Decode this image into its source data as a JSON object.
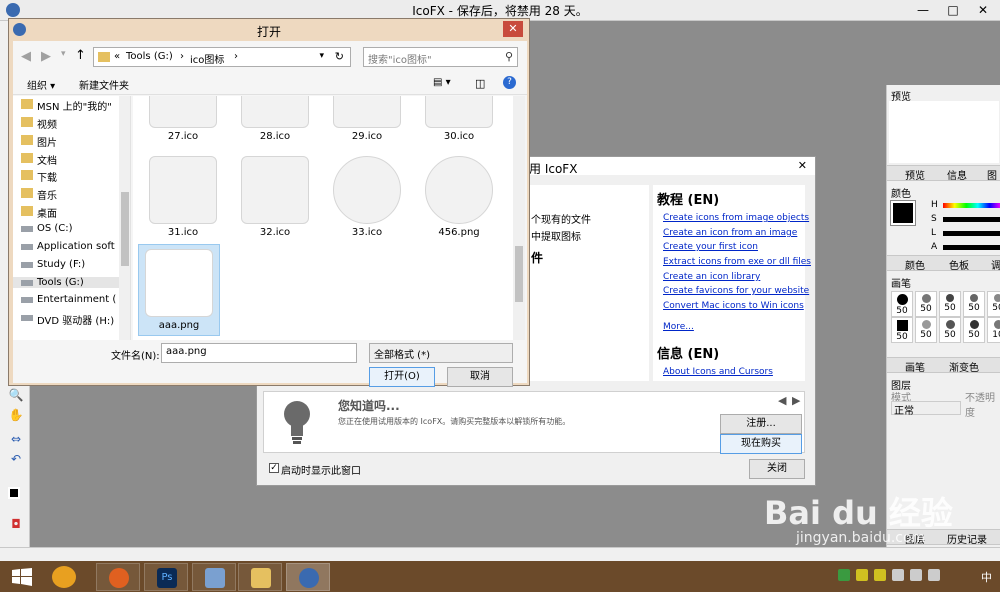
{
  "app": {
    "title": "IcoFX - 保存后，将禁用 28 天。"
  },
  "colors": {
    "taskbar": "#6b4a2a",
    "dialog_frame": "#eed9c0",
    "link": "#0026c8",
    "selection": "#cce4f7"
  },
  "file_dialog": {
    "title": "打开",
    "address": [
      "«",
      "Tools (G:)",
      "›",
      "ico图标",
      "›"
    ],
    "search_placeholder": "搜索\"ico图标\"",
    "organize": "组织 ▾",
    "new_folder": "新建文件夹",
    "nav_items": [
      {
        "label": "MSN 上的\"我的\"",
        "icon": "folder-icon"
      },
      {
        "label": "视频",
        "icon": "folder-icon"
      },
      {
        "label": "图片",
        "icon": "folder-icon"
      },
      {
        "label": "文档",
        "icon": "folder-icon"
      },
      {
        "label": "下载",
        "icon": "folder-icon"
      },
      {
        "label": "音乐",
        "icon": "folder-icon"
      },
      {
        "label": "桌面",
        "icon": "folder-icon"
      },
      {
        "label": "OS (C:)",
        "icon": "drive-icon"
      },
      {
        "label": "Application soft",
        "icon": "drive-icon"
      },
      {
        "label": "Study (F:)",
        "icon": "drive-icon"
      },
      {
        "label": "Tools (G:)",
        "icon": "drive-icon"
      },
      {
        "label": "Entertainment (",
        "icon": "drive-icon"
      },
      {
        "label": "DVD 驱动器 (H:)",
        "icon": "drive-icon"
      }
    ],
    "files": [
      {
        "name": "27.ico"
      },
      {
        "name": "28.ico"
      },
      {
        "name": "29.ico"
      },
      {
        "name": "30.ico"
      },
      {
        "name": "31.ico"
      },
      {
        "name": "32.ico"
      },
      {
        "name": "33.ico"
      },
      {
        "name": "456.png"
      },
      {
        "name": "aaa.png"
      }
    ],
    "filename_label": "文件名(N):",
    "filename_value": "aaa.png",
    "filetype_value": "全部格式 (*)",
    "open_button": "打开(O)",
    "cancel_button": "取消"
  },
  "welcome": {
    "title_partial": "用 IcoFX",
    "left_lines": [
      "个现有的文件",
      "中提取图标",
      "件"
    ],
    "tutorials_heading": "教程 (EN)",
    "tutorial_links": [
      "Create icons from image objects",
      "Create an icon from an image",
      "Create your first icon",
      "Extract icons from exe or dll files",
      "Create an icon library",
      "Create favicons for your website",
      "Convert Mac icons to Win icons"
    ],
    "more": "More...",
    "info_heading": "信息 (EN)",
    "info_link": "About Icons and Cursors",
    "tip_title": "您知道吗...",
    "tip_text": "您正在使用试用版本的 IcoFX。请购买完整版本以解锁所有功能。",
    "register_button": "注册...",
    "buy_button": "现在购买",
    "show_at_startup": "启动时显示此窗口",
    "close_button": "关闭"
  },
  "right_panel": {
    "preview": "预览",
    "tabs1": [
      "预览",
      "信息",
      "图"
    ],
    "color_label": "颜色",
    "hsl": [
      "H",
      "S",
      "L",
      "A"
    ],
    "tabs2": [
      "颜色",
      "色板",
      "调"
    ],
    "brush_label": "画笔",
    "brush_sizes": [
      "50",
      "50",
      "50",
      "50",
      "50",
      "50",
      "50",
      "50",
      "50",
      "10"
    ],
    "tabs3": [
      "画笔",
      "渐变色"
    ],
    "layers_label": "图层",
    "mode_label": "模式",
    "opacity_label": "不透明度",
    "mode_value": "正常",
    "history_label": "历史记录",
    "layers_tab": "图层"
  },
  "taskbar": {
    "clock": "中",
    "apps": [
      "windows-start-icon",
      "photo-app-icon",
      "firefox-icon",
      "photoshop-icon",
      "paint-icon",
      "explorer-icon",
      "icofx-icon"
    ]
  },
  "watermark": {
    "text": "Bai du 经验",
    "url": "jingyan.baidu.com"
  }
}
